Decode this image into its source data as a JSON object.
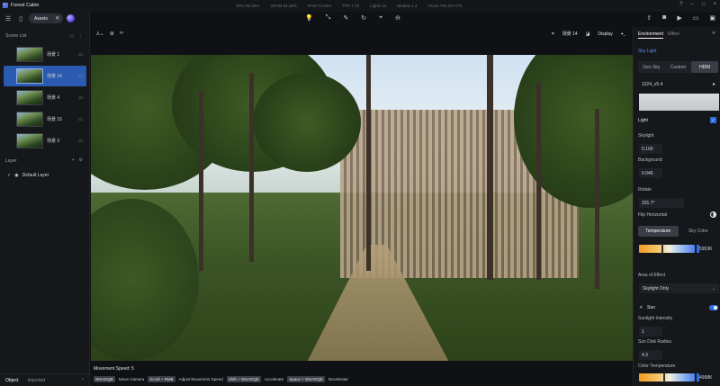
{
  "app": {
    "title": "Forest Cabin"
  },
  "stats": [
    "GPU 56.25%",
    "VRAM 84.28%",
    "RAM 74.33%",
    "TPS 7.79",
    "Lights 10",
    "Models 1.3",
    "Faces 750.327.071"
  ],
  "left_panel": {
    "assets_label": "Assets",
    "scene_list_title": "Scene List",
    "scenes": [
      {
        "name": "场景 1",
        "active": false
      },
      {
        "name": "场景 14",
        "active": true
      },
      {
        "name": "场景 4",
        "active": false
      },
      {
        "name": "场景 15",
        "active": false
      },
      {
        "name": "场景 3",
        "active": false
      }
    ],
    "layer_title": "Layer",
    "layers": [
      {
        "name": "Default Layer"
      }
    ],
    "bottom_tabs": [
      "Object",
      "Imported"
    ]
  },
  "viewport": {
    "scene_label": "场景 14",
    "display_label": "Display",
    "movement_speed": "Movement Speed: 5",
    "shortcuts": [
      {
        "key": "WSADQE",
        "action": "Move Camera"
      },
      {
        "key": "Scroll + RMB",
        "action": "Adjust Movement Speed"
      },
      {
        "key": "Shift + WSADQE",
        "action": "Accelerate"
      },
      {
        "key": "Space + WSADQE",
        "action": "Decelerate"
      }
    ]
  },
  "right_panel": {
    "tabs": [
      "Environment",
      "Effect"
    ],
    "sky_light_title": "Sky Light",
    "sky_modes": [
      "Geo Sky",
      "Custom",
      "HDRI"
    ],
    "hdri_name": "1224_v5.4",
    "light_title": "Light",
    "skylight_label": "Skylight",
    "skylight_value": "0.100",
    "background_label": "Background",
    "background_value": "0.046",
    "rotate_label": "Rotate",
    "rotate_value": "201.7°",
    "flip_label": "Flip Horizontal",
    "temp_tab": "Temperature",
    "sky_color_tab": "Sky Color",
    "temperature_value": "5953K",
    "area_label": "Area of Effect",
    "area_value": "Skylight Only",
    "sun_label": "Sun",
    "sunlight_intensity_label": "Sunlight Intensity",
    "sunlight_intensity_value": "1",
    "sun_disk_label": "Sun Disk Radius",
    "sun_disk_value": "4.3",
    "color_temp_label": "Color Temperature",
    "color_temp_value": "4998K"
  }
}
